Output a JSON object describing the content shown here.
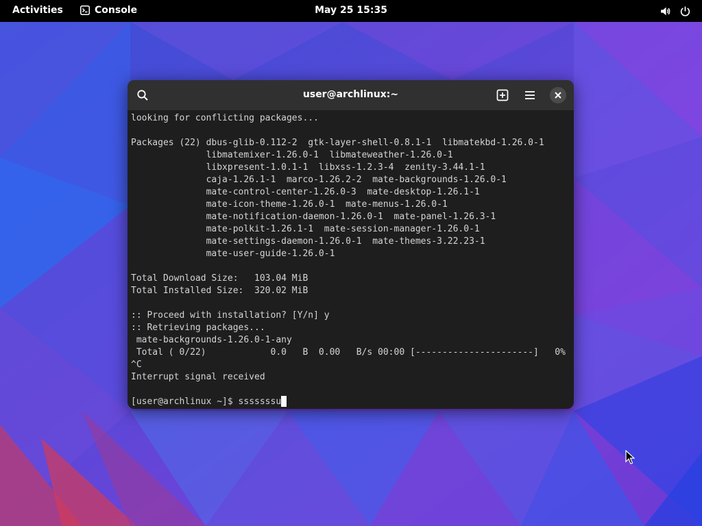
{
  "topbar": {
    "activities": "Activities",
    "app_name": "Console",
    "clock": "May 25  15:35",
    "icons": [
      "volume-icon",
      "power-icon"
    ]
  },
  "window": {
    "title": "user@archlinux:~",
    "header_icons": [
      "search-icon",
      "new-tab-icon",
      "menu-icon",
      "close-icon"
    ],
    "output_lines": [
      "looking for conflicting packages...",
      "",
      "Packages (22) dbus-glib-0.112-2  gtk-layer-shell-0.8.1-1  libmatekbd-1.26.0-1",
      "              libmatemixer-1.26.0-1  libmateweather-1.26.0-1",
      "              libxpresent-1.0.1-1  libxss-1.2.3-4  zenity-3.44.1-1",
      "              caja-1.26.1-1  marco-1.26.2-2  mate-backgrounds-1.26.0-1",
      "              mate-control-center-1.26.0-3  mate-desktop-1.26.1-1",
      "              mate-icon-theme-1.26.0-1  mate-menus-1.26.0-1",
      "              mate-notification-daemon-1.26.0-1  mate-panel-1.26.3-1",
      "              mate-polkit-1.26.1-1  mate-session-manager-1.26.0-1",
      "              mate-settings-daemon-1.26.0-1  mate-themes-3.22.23-1",
      "              mate-user-guide-1.26.0-1",
      "",
      "Total Download Size:   103.04 MiB",
      "Total Installed Size:  320.02 MiB",
      "",
      ":: Proceed with installation? [Y/n] y",
      ":: Retrieving packages...",
      " mate-backgrounds-1.26.0-1-any",
      " Total ( 0/22)            0.0   B  0.00   B/s 00:00 [----------------------]   0%",
      "^C",
      "Interrupt signal received",
      ""
    ],
    "prompt": "[user@archlinux ~]$ ",
    "command_input": "sssssssu"
  },
  "colors": {
    "topbar_bg": "#000000",
    "headerbar_bg": "#303030",
    "terminal_bg": "#1e1e1e",
    "terminal_fg": "#d4d4d4"
  }
}
